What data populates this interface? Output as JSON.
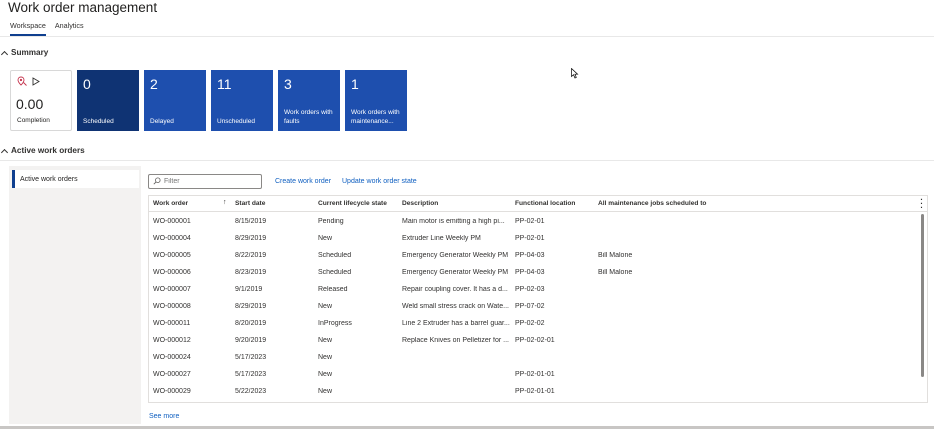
{
  "page": {
    "title": "Work order management"
  },
  "tabs": [
    {
      "label": "Workspace",
      "active": true
    },
    {
      "label": "Analytics",
      "active": false
    }
  ],
  "summary": {
    "header": "Summary",
    "kpi": {
      "value": "0.00",
      "label": "Completion",
      "icons": [
        "map-pin-icon",
        "play-icon"
      ]
    },
    "tiles": [
      {
        "count": "0",
        "label": "Scheduled"
      },
      {
        "count": "2",
        "label": "Delayed"
      },
      {
        "count": "11",
        "label": "Unscheduled"
      },
      {
        "count": "3",
        "label": "Work orders with faults"
      },
      {
        "count": "1",
        "label": "Work orders with maintenance..."
      }
    ]
  },
  "active_work_orders": {
    "header": "Active work orders",
    "nav_item": "Active work orders",
    "filter_placeholder": "Filter",
    "actions": {
      "create": "Create work order",
      "update": "Update work order state"
    },
    "columns": [
      "Work order",
      "Start date",
      "Current lifecycle state",
      "Description",
      "Functional location",
      "All maintenance jobs scheduled to"
    ],
    "sort_indicator": "↑",
    "rows": [
      [
        "WO-000001",
        "8/15/2019",
        "Pending",
        "Main motor is emitting a high pi...",
        "PP-02-01",
        ""
      ],
      [
        "WO-000004",
        "8/29/2019",
        "New",
        "Extruder Line Weekly PM",
        "PP-02-01",
        ""
      ],
      [
        "WO-000005",
        "8/22/2019",
        "Scheduled",
        "Emergency Generator Weekly PM",
        "PP-04-03",
        "Bill Malone"
      ],
      [
        "WO-000006",
        "8/23/2019",
        "Scheduled",
        "Emergency Generator Weekly PM",
        "PP-04-03",
        "Bill Malone"
      ],
      [
        "WO-000007",
        "9/1/2019",
        "Released",
        "Repair coupling cover. It has a d...",
        "PP-02-03",
        ""
      ],
      [
        "WO-000008",
        "8/29/2019",
        "New",
        "Weld small stress crack on Wate...",
        "PP-07-02",
        ""
      ],
      [
        "WO-000011",
        "8/20/2019",
        "InProgress",
        "Line 2 Extruder has a barrel guar...",
        "PP-02-02",
        ""
      ],
      [
        "WO-000012",
        "9/20/2019",
        "New",
        "Replace Knives on Pelletizer for ...",
        "PP-02-02-01",
        ""
      ],
      [
        "WO-000024",
        "5/17/2023",
        "New",
        "",
        "",
        ""
      ],
      [
        "WO-000027",
        "5/17/2023",
        "New",
        "",
        "PP-02-01-01",
        ""
      ],
      [
        "WO-000029",
        "5/22/2023",
        "New",
        "",
        "PP-02-01-01",
        ""
      ]
    ],
    "see_more": "See more"
  },
  "colors": {
    "accent": "#0f3f8f",
    "tile": "#1e4fae",
    "tile_dark": "#0f3373",
    "link": "#0f5fc0"
  }
}
